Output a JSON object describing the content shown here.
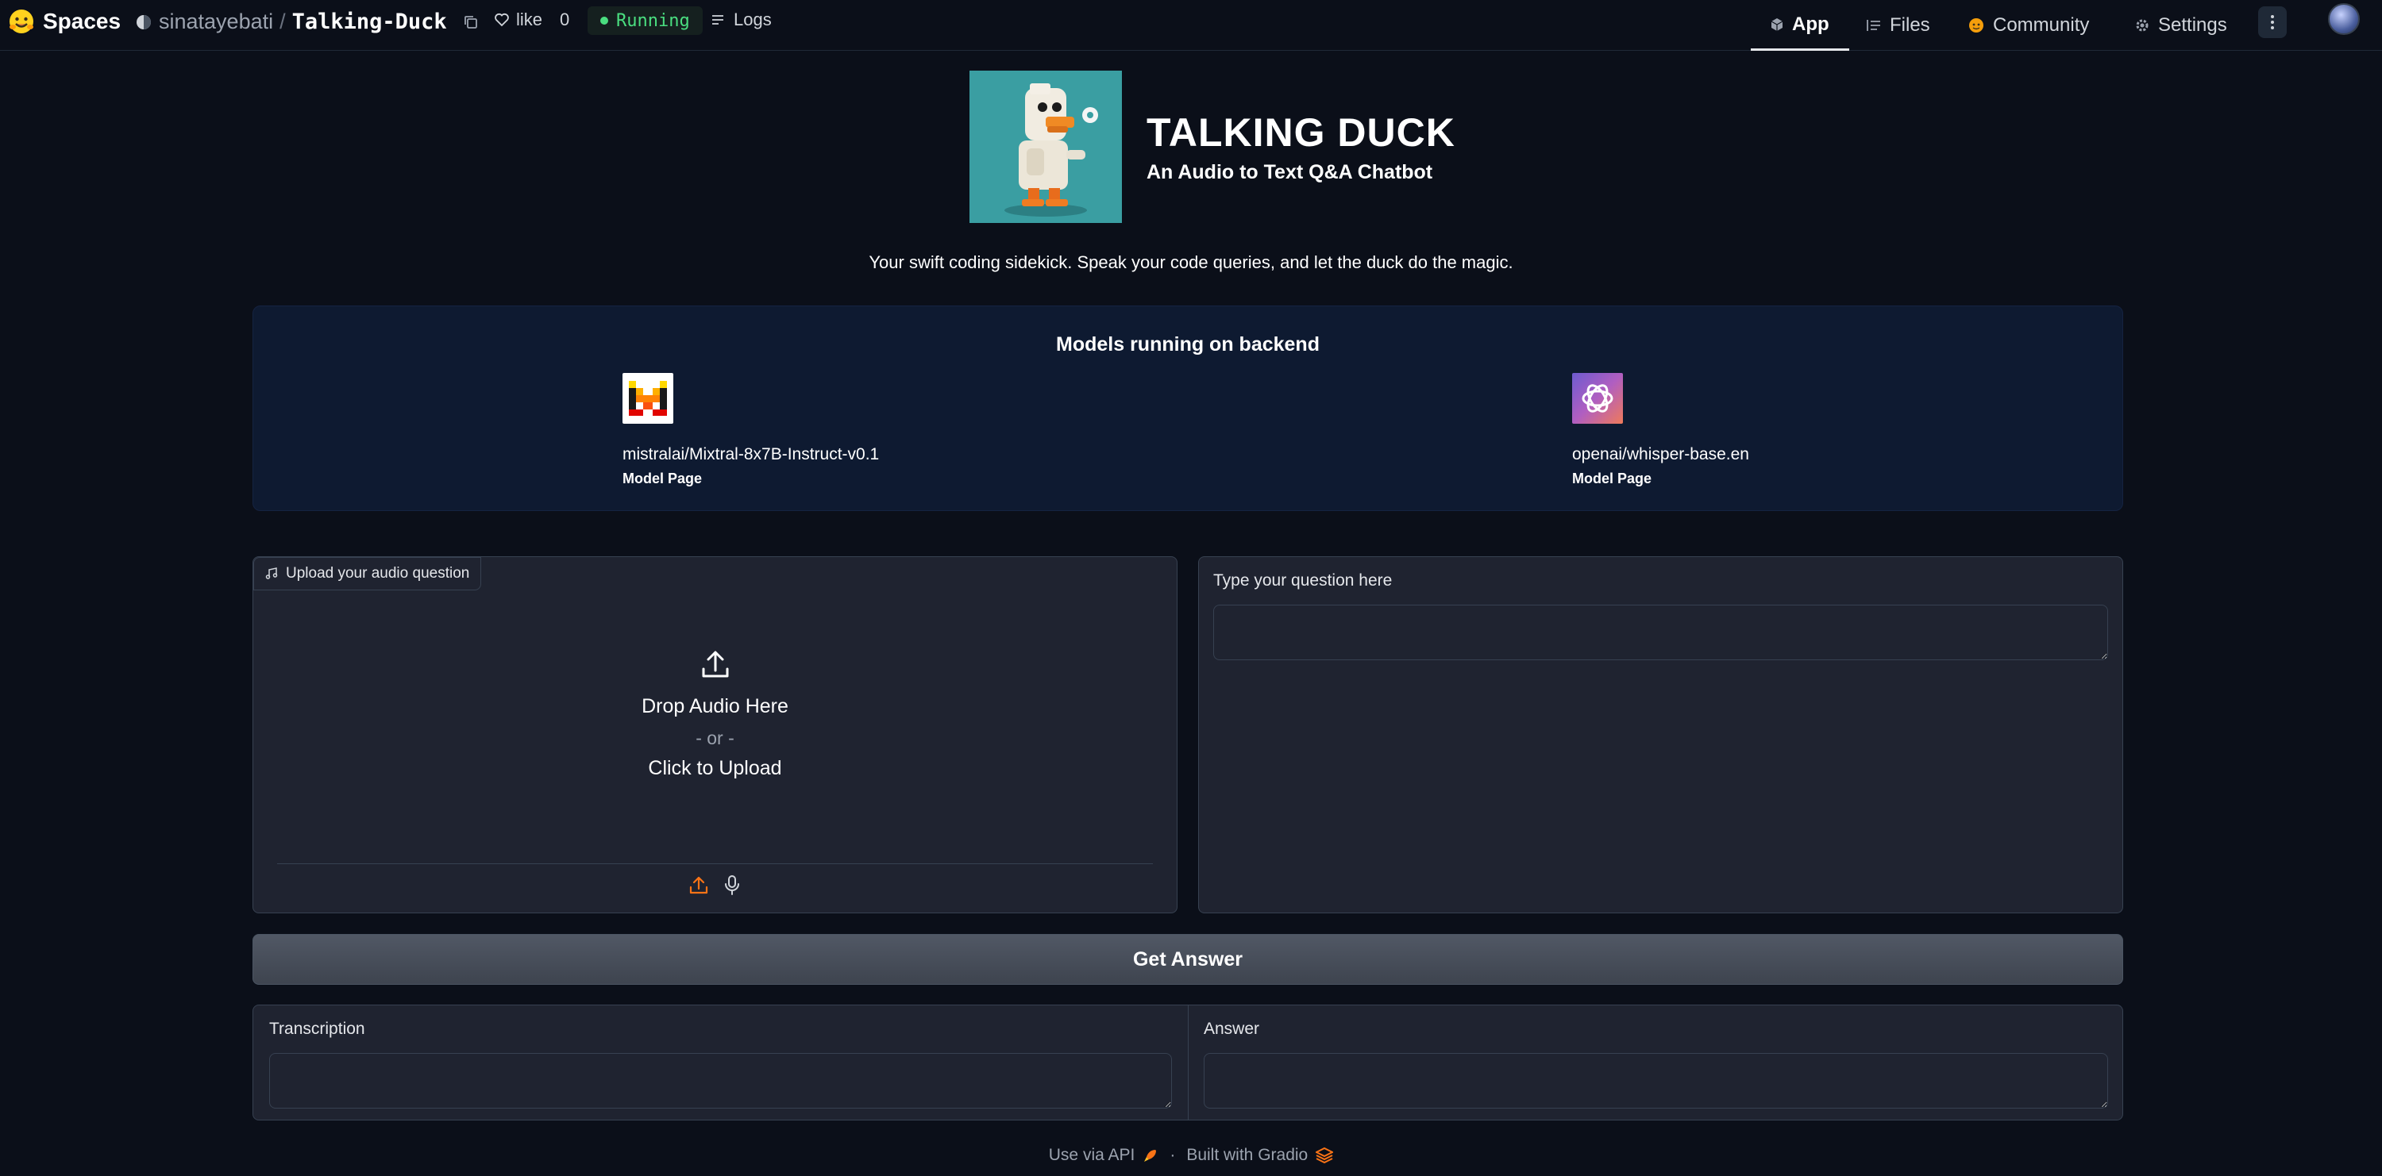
{
  "topbar": {
    "brand": "Spaces",
    "repo_owner": "sinatayebati",
    "repo_sep": "/",
    "repo_name": "Talking-Duck",
    "like_label": "like",
    "like_count": "0",
    "status": "Running",
    "logs_label": "Logs",
    "nav": {
      "app": "App",
      "files": "Files",
      "community": "Community",
      "settings": "Settings"
    }
  },
  "header": {
    "title": "TALKING DUCK",
    "subtitle": "An Audio to Text Q&A Chatbot",
    "tagline": "Your swift coding sidekick. Speak your code queries, and let the duck do the magic."
  },
  "models": {
    "title": "Models running on backend",
    "items": [
      {
        "name": "mistralai/Mixtral-8x7B-Instruct-v0.1",
        "link": "Model Page"
      },
      {
        "name": "openai/whisper-base.en",
        "link": "Model Page"
      }
    ]
  },
  "audio": {
    "label": "Upload your audio question",
    "drop_main": "Drop Audio Here",
    "drop_or": "- or -",
    "drop_click": "Click to Upload"
  },
  "question": {
    "label": "Type your question here",
    "value": ""
  },
  "submit_label": "Get Answer",
  "outputs": {
    "transcription_label": "Transcription",
    "transcription_value": "",
    "answer_label": "Answer",
    "answer_value": ""
  },
  "footer": {
    "api": "Use via API",
    "sep": "·",
    "built": "Built with Gradio"
  },
  "colors": {
    "background": "#0b0f19",
    "panel": "#1f2330",
    "models_panel": "#0e1a31",
    "running": "#4ade80",
    "accent": "#f97316"
  }
}
